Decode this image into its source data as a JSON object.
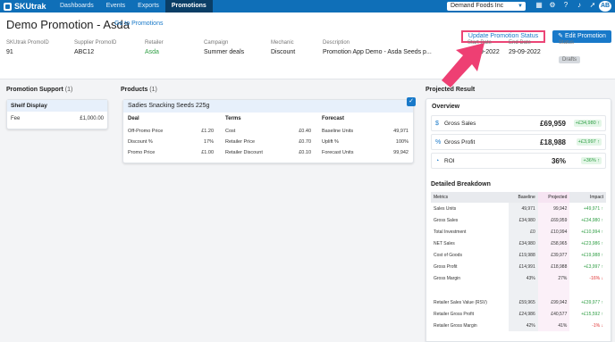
{
  "nav": {
    "logo": "SKUtrak",
    "links": [
      "Dashboards",
      "Events",
      "Exports",
      "Promotions"
    ],
    "active": "Promotions",
    "org": "Demand Foods Inc",
    "avatar": "AB"
  },
  "header": {
    "title": "Demo Promotion - Asda",
    "goto": "Go to Promotions",
    "update_button": "Update Promotion Status",
    "edit_button": "Edit Promotion",
    "fields": [
      {
        "label": "SKUtrak PromoID",
        "value": "91"
      },
      {
        "label": "Supplier PromoID",
        "value": "ABC12"
      },
      {
        "label": "Retailer",
        "value": "Asda"
      },
      {
        "label": "Campaign",
        "value": "Summer deals"
      },
      {
        "label": "Mechanic",
        "value": "Discount"
      },
      {
        "label": "Description",
        "value": "Promotion App Demo - Asda Seeds p..."
      },
      {
        "label": "Start Date",
        "value": "01-09-2022"
      },
      {
        "label": "End Date",
        "value": "29-09-2022"
      },
      {
        "label": "Status",
        "value": "Drafts"
      }
    ]
  },
  "support": {
    "title": "Promotion Support",
    "count": "(1)",
    "card_title": "Shelf Display",
    "fee_label": "Fee",
    "fee_value": "£1,000.00"
  },
  "products": {
    "title": "Products",
    "count": "(1)",
    "card_title": "Sadies Snacking Seeds 225g",
    "deal": {
      "heading": "Deal",
      "rows": [
        {
          "label": "Off-Promo Price",
          "value": "£1.20"
        },
        {
          "label": "Discount %",
          "value": "17%"
        },
        {
          "label": "Promo Price",
          "value": "£1.00"
        }
      ]
    },
    "terms": {
      "heading": "Terms",
      "rows": [
        {
          "label": "Cost",
          "value": "£0.40"
        },
        {
          "label": "Retailer Price",
          "value": "£0.70"
        },
        {
          "label": "Retailer Discount",
          "value": "£0.10"
        }
      ]
    },
    "forecast": {
      "heading": "Forecast",
      "rows": [
        {
          "label": "Baseline Units",
          "value": "49,971"
        },
        {
          "label": "Uplift %",
          "value": "100%"
        },
        {
          "label": "Forecast Units",
          "value": "99,942"
        }
      ]
    }
  },
  "result": {
    "title": "Projected Result",
    "overview_title": "Overview",
    "overview": [
      {
        "icon": "$",
        "label": "Gross Sales",
        "value": "£69,959",
        "delta": "+£34,980"
      },
      {
        "icon": "%",
        "label": "Gross Profit",
        "value": "£18,988",
        "delta": "+£3,997"
      },
      {
        "icon": "◔",
        "label": "ROI",
        "value": "36%",
        "delta": "+36%"
      }
    ],
    "breakdown_title": "Detailed Breakdown",
    "headers": [
      "Metrics",
      "Baseline",
      "Projected",
      "Impact"
    ],
    "rows": [
      {
        "metric": "Sales Units",
        "base": "49,971",
        "proj": "99,942",
        "impact": "+49,971",
        "dir": "up"
      },
      {
        "metric": "Gross Sales",
        "base": "£34,980",
        "proj": "£69,959",
        "impact": "+£34,980",
        "dir": "up"
      },
      {
        "metric": "Total Investment",
        "base": "£0",
        "proj": "£10,994",
        "impact": "+£10,994",
        "dir": "up"
      },
      {
        "metric": "NET Sales",
        "base": "£34,980",
        "proj": "£58,965",
        "impact": "+£23,986",
        "dir": "up"
      },
      {
        "metric": "Cost of Goods",
        "base": "£19,988",
        "proj": "£39,977",
        "impact": "+£19,988",
        "dir": "up"
      },
      {
        "metric": "Gross Profit",
        "base": "£14,991",
        "proj": "£18,988",
        "impact": "+£3,997",
        "dir": "up"
      },
      {
        "metric": "Gross Margin",
        "base": "43%",
        "proj": "27%",
        "impact": "-16%",
        "dir": "down"
      },
      {
        "metric": "",
        "base": "",
        "proj": "",
        "impact": "",
        "dir": "none"
      },
      {
        "metric": "Retailer Sales Value (RSV)",
        "base": "£59,965",
        "proj": "£99,942",
        "impact": "+£39,977",
        "dir": "up"
      },
      {
        "metric": "Retailer Gross Profit",
        "base": "£24,986",
        "proj": "£40,577",
        "impact": "+£15,592",
        "dir": "up"
      },
      {
        "metric": "Retailer Gross Margin",
        "base": "42%",
        "proj": "41%",
        "impact": "-1%",
        "dir": "down"
      }
    ]
  }
}
